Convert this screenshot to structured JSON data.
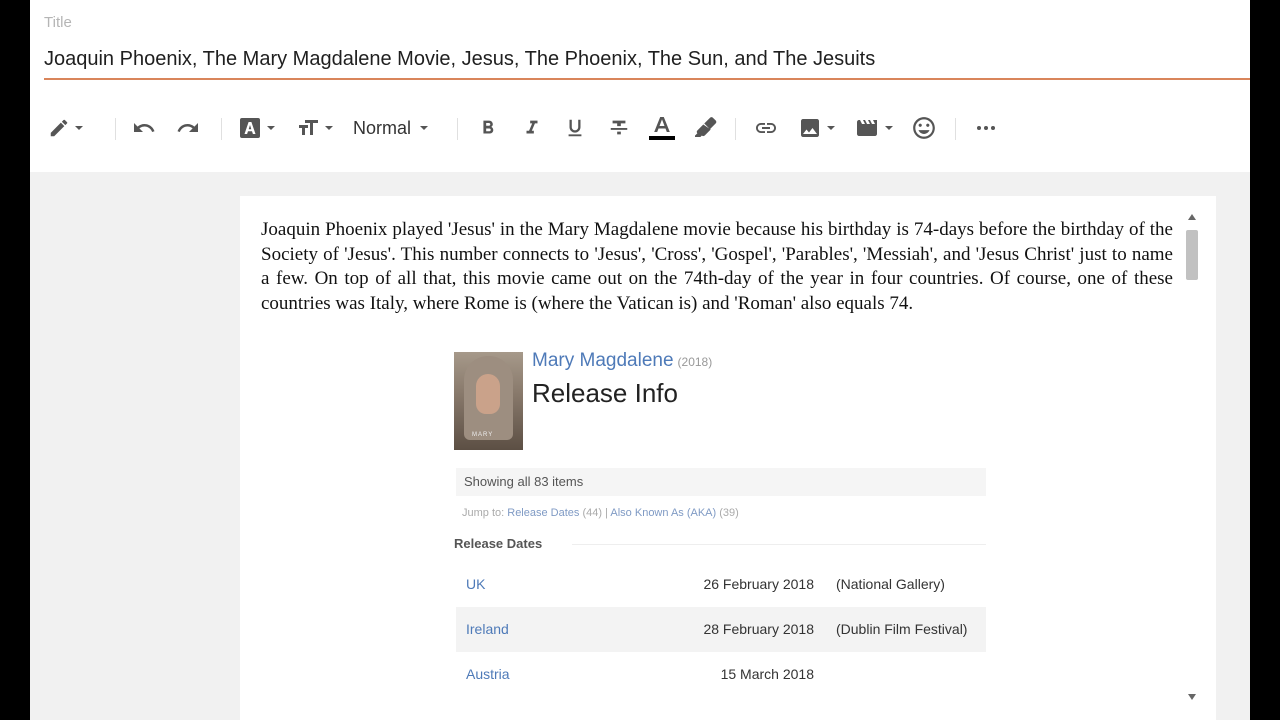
{
  "title": {
    "label": "Title",
    "value": "Joaquin Phoenix, The Mary Magdalene Movie, Jesus, The Phoenix, The Sun, and The Jesuits"
  },
  "toolbar": {
    "paragraph_style": "Normal",
    "icons": [
      "pencil-icon",
      "undo-icon",
      "redo-icon",
      "font-icon",
      "text-size-icon",
      "bold-icon",
      "italic-icon",
      "underline-icon",
      "strikethrough-icon",
      "text-color-icon",
      "highlight-icon",
      "link-icon",
      "image-icon",
      "video-icon",
      "emoji-icon",
      "more-icon"
    ],
    "text_color_underline": "#000000"
  },
  "body": {
    "paragraph": "Joaquin Phoenix played 'Jesus' in the Mary Magdalene movie because his birthday is 74-days before the birthday of the Society of 'Jesus'. This number connects to 'Jesus', 'Cross', 'Gospel', 'Parables', 'Messiah', and 'Jesus Christ' just to name a few. On top of all that, this movie came out on the 74th-day of the year in four countries. Of course, one of these countries was Italy, where Rome is (where the Vatican is) and 'Roman' also equals 74."
  },
  "embed": {
    "poster_word": "MARY",
    "movie_title": "Mary Magdalene",
    "movie_year": "(2018)",
    "heading": "Release Info",
    "showing": "Showing all 83 items",
    "jump_label": "Jump to:",
    "jump_links": [
      {
        "label": "Release Dates",
        "count": "(44)"
      },
      {
        "label": "Also Known As (AKA)",
        "count": "(39)"
      }
    ],
    "section": "Release Dates",
    "rows": [
      {
        "country": "UK",
        "date": "26 February 2018",
        "note": "(National Gallery)"
      },
      {
        "country": "Ireland",
        "date": "28 February 2018",
        "note": "(Dublin Film Festival)"
      },
      {
        "country": "Austria",
        "date": "15 March 2018",
        "note": ""
      }
    ]
  },
  "colors": {
    "title_underline": "#d9855b",
    "link_blue": "#4e7ab8"
  }
}
